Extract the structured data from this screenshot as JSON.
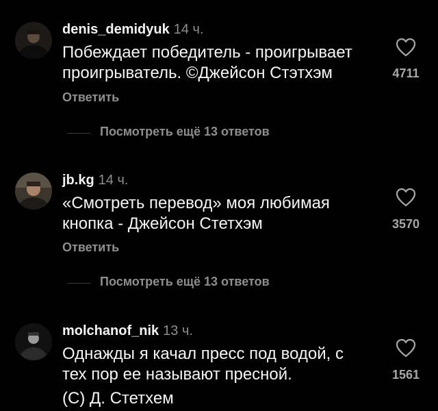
{
  "comments": [
    {
      "username": "denis_demidyuk",
      "time": "14 ч.",
      "text_lines": [
        "Побеждает победитель - проигрывает",
        "проигрыватель. ©Джейсон Стэтхэм"
      ],
      "likes": "4711",
      "reply_label": "Ответить",
      "more_replies_label": "Посмотреть ещё 13 ответов"
    },
    {
      "username": "jb.kg",
      "time": "14 ч.",
      "text_lines": [
        "«Смотреть перевод»  моя любимая",
        "кнопка - Джейсон Стетхэм"
      ],
      "likes": "3570",
      "reply_label": "Ответить",
      "more_replies_label": "Посмотреть ещё 13 ответов"
    },
    {
      "username": "molchanof_nik",
      "time": "13 ч.",
      "text_lines": [
        "Однажды я качал пресс под водой, с",
        "тех пор ее называют пресной.",
        "(С) Д. Стетхем"
      ],
      "likes": "1561"
    }
  ],
  "icons": {
    "like": "heart-outline-icon"
  },
  "colors": {
    "background": "#000000",
    "primary_text": "#f5f5f5",
    "secondary_text": "#8e8e8e",
    "likes_text": "#a8a8a8"
  }
}
